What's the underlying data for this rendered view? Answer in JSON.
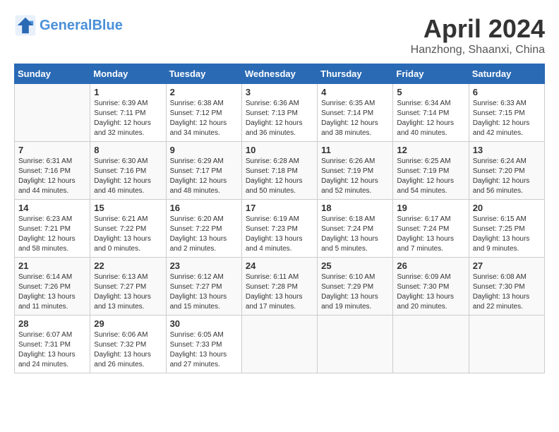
{
  "header": {
    "logo_line1": "General",
    "logo_line2": "Blue",
    "month": "April 2024",
    "location": "Hanzhong, Shaanxi, China"
  },
  "weekdays": [
    "Sunday",
    "Monday",
    "Tuesday",
    "Wednesday",
    "Thursday",
    "Friday",
    "Saturday"
  ],
  "weeks": [
    [
      {
        "day": null
      },
      {
        "day": "1",
        "sunrise": "Sunrise: 6:39 AM",
        "sunset": "Sunset: 7:11 PM",
        "daylight": "Daylight: 12 hours and 32 minutes."
      },
      {
        "day": "2",
        "sunrise": "Sunrise: 6:38 AM",
        "sunset": "Sunset: 7:12 PM",
        "daylight": "Daylight: 12 hours and 34 minutes."
      },
      {
        "day": "3",
        "sunrise": "Sunrise: 6:36 AM",
        "sunset": "Sunset: 7:13 PM",
        "daylight": "Daylight: 12 hours and 36 minutes."
      },
      {
        "day": "4",
        "sunrise": "Sunrise: 6:35 AM",
        "sunset": "Sunset: 7:14 PM",
        "daylight": "Daylight: 12 hours and 38 minutes."
      },
      {
        "day": "5",
        "sunrise": "Sunrise: 6:34 AM",
        "sunset": "Sunset: 7:14 PM",
        "daylight": "Daylight: 12 hours and 40 minutes."
      },
      {
        "day": "6",
        "sunrise": "Sunrise: 6:33 AM",
        "sunset": "Sunset: 7:15 PM",
        "daylight": "Daylight: 12 hours and 42 minutes."
      }
    ],
    [
      {
        "day": "7",
        "sunrise": "Sunrise: 6:31 AM",
        "sunset": "Sunset: 7:16 PM",
        "daylight": "Daylight: 12 hours and 44 minutes."
      },
      {
        "day": "8",
        "sunrise": "Sunrise: 6:30 AM",
        "sunset": "Sunset: 7:16 PM",
        "daylight": "Daylight: 12 hours and 46 minutes."
      },
      {
        "day": "9",
        "sunrise": "Sunrise: 6:29 AM",
        "sunset": "Sunset: 7:17 PM",
        "daylight": "Daylight: 12 hours and 48 minutes."
      },
      {
        "day": "10",
        "sunrise": "Sunrise: 6:28 AM",
        "sunset": "Sunset: 7:18 PM",
        "daylight": "Daylight: 12 hours and 50 minutes."
      },
      {
        "day": "11",
        "sunrise": "Sunrise: 6:26 AM",
        "sunset": "Sunset: 7:19 PM",
        "daylight": "Daylight: 12 hours and 52 minutes."
      },
      {
        "day": "12",
        "sunrise": "Sunrise: 6:25 AM",
        "sunset": "Sunset: 7:19 PM",
        "daylight": "Daylight: 12 hours and 54 minutes."
      },
      {
        "day": "13",
        "sunrise": "Sunrise: 6:24 AM",
        "sunset": "Sunset: 7:20 PM",
        "daylight": "Daylight: 12 hours and 56 minutes."
      }
    ],
    [
      {
        "day": "14",
        "sunrise": "Sunrise: 6:23 AM",
        "sunset": "Sunset: 7:21 PM",
        "daylight": "Daylight: 12 hours and 58 minutes."
      },
      {
        "day": "15",
        "sunrise": "Sunrise: 6:21 AM",
        "sunset": "Sunset: 7:22 PM",
        "daylight": "Daylight: 13 hours and 0 minutes."
      },
      {
        "day": "16",
        "sunrise": "Sunrise: 6:20 AM",
        "sunset": "Sunset: 7:22 PM",
        "daylight": "Daylight: 13 hours and 2 minutes."
      },
      {
        "day": "17",
        "sunrise": "Sunrise: 6:19 AM",
        "sunset": "Sunset: 7:23 PM",
        "daylight": "Daylight: 13 hours and 4 minutes."
      },
      {
        "day": "18",
        "sunrise": "Sunrise: 6:18 AM",
        "sunset": "Sunset: 7:24 PM",
        "daylight": "Daylight: 13 hours and 5 minutes."
      },
      {
        "day": "19",
        "sunrise": "Sunrise: 6:17 AM",
        "sunset": "Sunset: 7:24 PM",
        "daylight": "Daylight: 13 hours and 7 minutes."
      },
      {
        "day": "20",
        "sunrise": "Sunrise: 6:15 AM",
        "sunset": "Sunset: 7:25 PM",
        "daylight": "Daylight: 13 hours and 9 minutes."
      }
    ],
    [
      {
        "day": "21",
        "sunrise": "Sunrise: 6:14 AM",
        "sunset": "Sunset: 7:26 PM",
        "daylight": "Daylight: 13 hours and 11 minutes."
      },
      {
        "day": "22",
        "sunrise": "Sunrise: 6:13 AM",
        "sunset": "Sunset: 7:27 PM",
        "daylight": "Daylight: 13 hours and 13 minutes."
      },
      {
        "day": "23",
        "sunrise": "Sunrise: 6:12 AM",
        "sunset": "Sunset: 7:27 PM",
        "daylight": "Daylight: 13 hours and 15 minutes."
      },
      {
        "day": "24",
        "sunrise": "Sunrise: 6:11 AM",
        "sunset": "Sunset: 7:28 PM",
        "daylight": "Daylight: 13 hours and 17 minutes."
      },
      {
        "day": "25",
        "sunrise": "Sunrise: 6:10 AM",
        "sunset": "Sunset: 7:29 PM",
        "daylight": "Daylight: 13 hours and 19 minutes."
      },
      {
        "day": "26",
        "sunrise": "Sunrise: 6:09 AM",
        "sunset": "Sunset: 7:30 PM",
        "daylight": "Daylight: 13 hours and 20 minutes."
      },
      {
        "day": "27",
        "sunrise": "Sunrise: 6:08 AM",
        "sunset": "Sunset: 7:30 PM",
        "daylight": "Daylight: 13 hours and 22 minutes."
      }
    ],
    [
      {
        "day": "28",
        "sunrise": "Sunrise: 6:07 AM",
        "sunset": "Sunset: 7:31 PM",
        "daylight": "Daylight: 13 hours and 24 minutes."
      },
      {
        "day": "29",
        "sunrise": "Sunrise: 6:06 AM",
        "sunset": "Sunset: 7:32 PM",
        "daylight": "Daylight: 13 hours and 26 minutes."
      },
      {
        "day": "30",
        "sunrise": "Sunrise: 6:05 AM",
        "sunset": "Sunset: 7:33 PM",
        "daylight": "Daylight: 13 hours and 27 minutes."
      },
      {
        "day": null
      },
      {
        "day": null
      },
      {
        "day": null
      },
      {
        "day": null
      }
    ]
  ]
}
